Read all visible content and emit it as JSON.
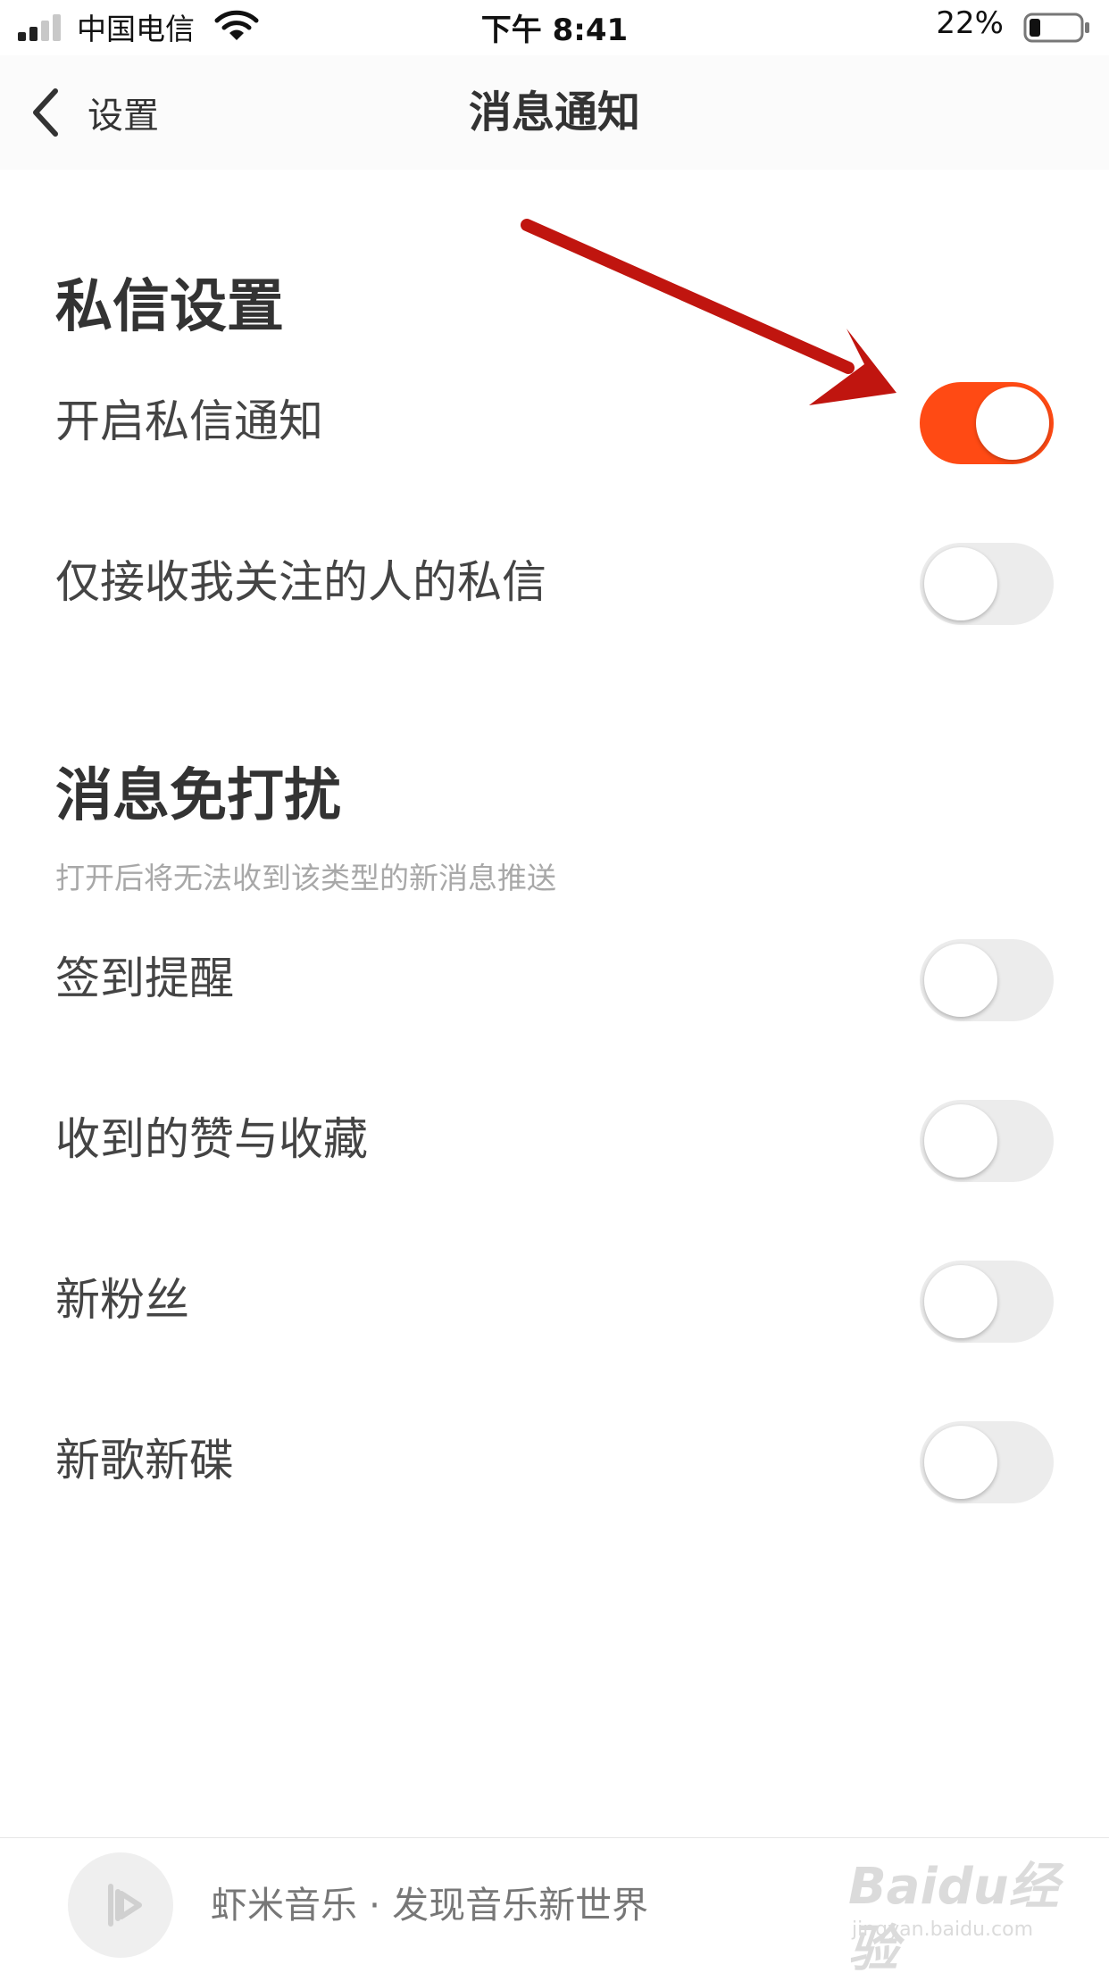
{
  "status_bar": {
    "carrier": "中国电信",
    "time": "下午 8:41",
    "battery": "22%"
  },
  "nav": {
    "back_label": "设置",
    "title": "消息通知"
  },
  "sections": [
    {
      "title": "私信设置",
      "items": [
        {
          "label": "开启私信通知",
          "enabled": true
        },
        {
          "label": "仅接收我关注的人的私信",
          "enabled": false
        }
      ]
    },
    {
      "title": "消息免打扰",
      "subtitle": "打开后将无法收到该类型的新消息推送",
      "items": [
        {
          "label": "签到提醒",
          "enabled": false
        },
        {
          "label": "收到的赞与收藏",
          "enabled": false
        },
        {
          "label": "新粉丝",
          "enabled": false
        },
        {
          "label": "新歌新碟",
          "enabled": false
        }
      ]
    }
  ],
  "player": {
    "text": "虾米音乐 · 发现音乐新世界"
  },
  "watermark": {
    "brand": "Baidu经验",
    "url": "jingyan.baidu.com"
  },
  "colors": {
    "accent": "#ff4a14",
    "annotation_arrow": "#c0150f"
  }
}
